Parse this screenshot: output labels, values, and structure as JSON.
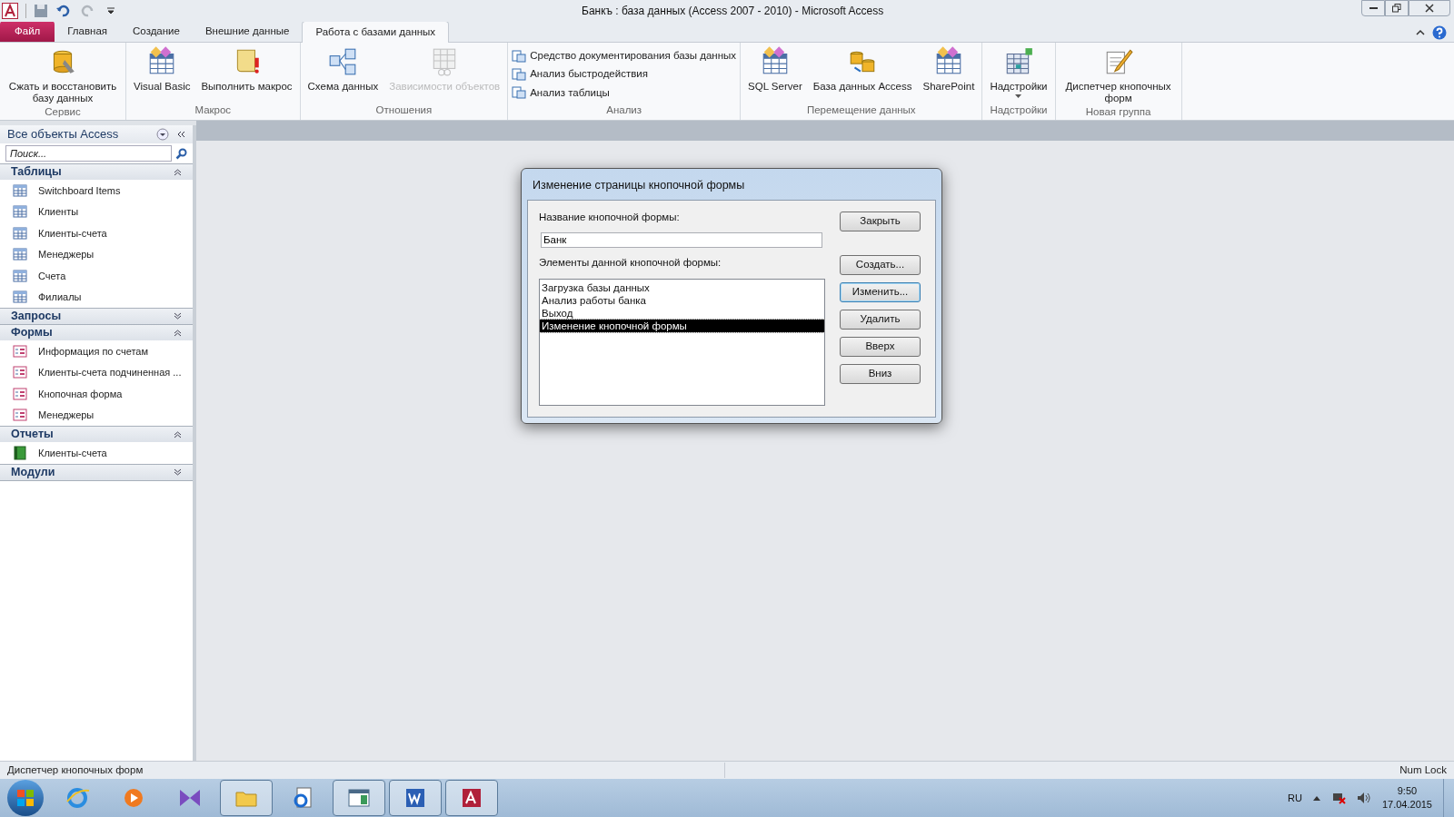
{
  "window": {
    "title": "Банкъ : база данных (Access 2007 - 2010)  -  Microsoft Access"
  },
  "ribbon": {
    "tabs": [
      {
        "label": "Файл",
        "kind": "file",
        "selected": false
      },
      {
        "label": "Главная",
        "kind": "tab",
        "selected": false
      },
      {
        "label": "Создание",
        "kind": "tab",
        "selected": false
      },
      {
        "label": "Внешние данные",
        "kind": "tab",
        "selected": false
      },
      {
        "label": "Работа с базами данных",
        "kind": "tab",
        "selected": true
      }
    ],
    "groups": [
      {
        "label": "Сервис",
        "kind": "large",
        "buttons": [
          {
            "label": "Сжать и восстановить базу данных",
            "disabled": false
          }
        ]
      },
      {
        "label": "Макрос",
        "kind": "large",
        "buttons": [
          {
            "label": "Visual Basic",
            "disabled": false
          },
          {
            "label": "Выполнить макрос",
            "disabled": false
          }
        ]
      },
      {
        "label": "Отношения",
        "kind": "large",
        "buttons": [
          {
            "label": "Схема данных",
            "disabled": false
          },
          {
            "label": "Зависимости объектов",
            "disabled": true
          }
        ]
      },
      {
        "label": "Анализ",
        "kind": "list",
        "buttons": [
          {
            "label": "Средство документирования базы данных",
            "disabled": false
          },
          {
            "label": "Анализ быстродействия",
            "disabled": false
          },
          {
            "label": "Анализ таблицы",
            "disabled": false
          }
        ]
      },
      {
        "label": "Перемещение данных",
        "kind": "large",
        "buttons": [
          {
            "label": "SQL Server",
            "disabled": false
          },
          {
            "label": "База данных Access",
            "disabled": false
          },
          {
            "label": "SharePoint",
            "disabled": false
          }
        ]
      },
      {
        "label": "Надстройки",
        "kind": "large",
        "buttons": [
          {
            "label": "Надстройки",
            "disabled": false
          }
        ]
      },
      {
        "label": "Новая группа",
        "kind": "large",
        "buttons": [
          {
            "label": "Диспетчер кнопочных форм",
            "disabled": false
          }
        ]
      }
    ]
  },
  "nav_pane": {
    "title": "Все объекты Access",
    "search": {
      "placeholder": "Поиск..."
    },
    "groups": [
      {
        "label": "Таблицы",
        "expanded": true,
        "items": [
          {
            "label": "Switchboard Items",
            "kind": "table"
          },
          {
            "label": "Клиенты",
            "kind": "table"
          },
          {
            "label": "Клиенты-счета",
            "kind": "table"
          },
          {
            "label": "Менеджеры",
            "kind": "table"
          },
          {
            "label": "Счета",
            "kind": "table"
          },
          {
            "label": "Филиалы",
            "kind": "table"
          }
        ]
      },
      {
        "label": "Запросы",
        "expanded": false
      },
      {
        "label": "Формы",
        "expanded": true,
        "items": [
          {
            "label": "Информация по счетам",
            "kind": "form"
          },
          {
            "label": "Клиенты-счета подчиненная ...",
            "kind": "form"
          },
          {
            "label": "Кнопочная форма",
            "kind": "form"
          },
          {
            "label": "Менеджеры",
            "kind": "form"
          }
        ]
      },
      {
        "label": "Отчеты",
        "expanded": true,
        "items": [
          {
            "label": "Клиенты-счета",
            "kind": "report"
          }
        ]
      },
      {
        "label": "Модули",
        "expanded": false
      }
    ]
  },
  "dialog": {
    "title": "Изменение страницы кнопочной формы",
    "name_label": "Название кнопочной формы:",
    "name_value": "Банк",
    "items_label": "Элементы данной кнопочной формы:",
    "items": [
      {
        "label": "Загрузка базы данных",
        "selected": false
      },
      {
        "label": "Анализ работы банка",
        "selected": false
      },
      {
        "label": "Выход",
        "selected": false
      },
      {
        "label": "Изменение кнопочной формы",
        "selected": true
      }
    ],
    "buttons": [
      {
        "label": "Закрыть",
        "focused": false
      },
      {
        "label": "Создать...",
        "focused": false
      },
      {
        "label": "Изменить...",
        "focused": true
      },
      {
        "label": "Удалить",
        "focused": false
      },
      {
        "label": "Вверх",
        "focused": false
      },
      {
        "label": "Вниз",
        "focused": false
      }
    ]
  },
  "status_bar": {
    "message": "Диспетчер кнопочных форм",
    "indicator": "Num Lock"
  },
  "taskbar": {
    "apps": [
      {
        "running": false
      },
      {
        "running": false
      },
      {
        "running": false
      },
      {
        "running": true
      },
      {
        "running": false
      },
      {
        "running": true
      },
      {
        "running": true
      },
      {
        "running": true
      }
    ],
    "language": "RU",
    "time": "9:50",
    "date": "17.04.2015"
  }
}
